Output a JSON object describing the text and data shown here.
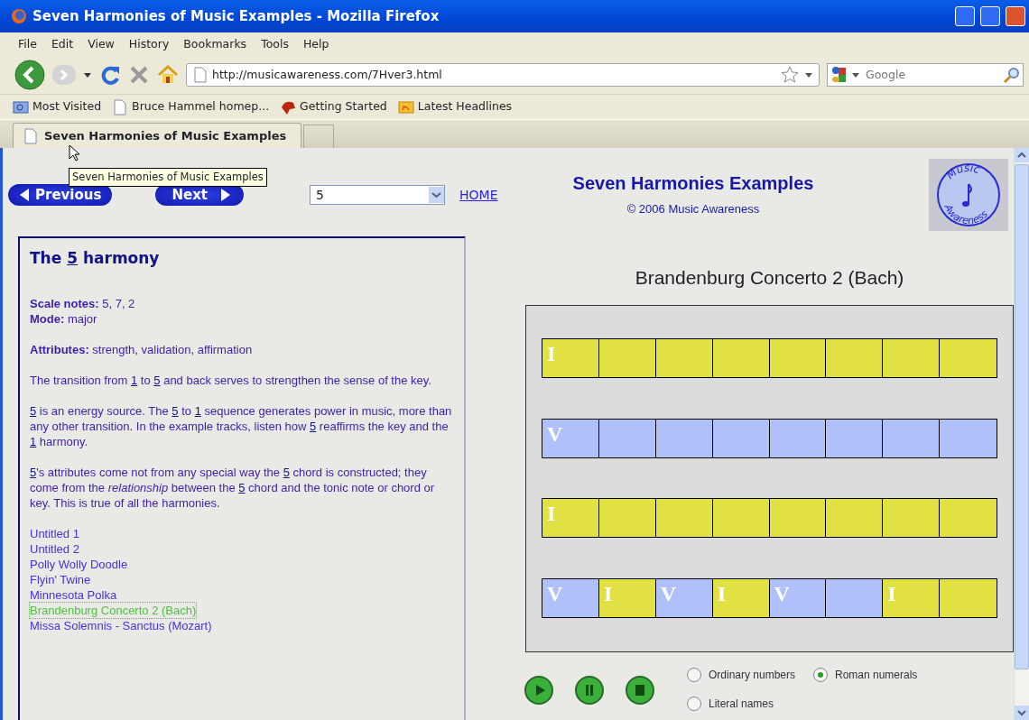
{
  "window": {
    "title": "Seven Harmonies of Music Examples - Mozilla Firefox"
  },
  "menu": [
    "File",
    "Edit",
    "View",
    "History",
    "Bookmarks",
    "Tools",
    "Help"
  ],
  "toolbar": {
    "url": "http://musicawareness.com/7Hver3.html",
    "search_placeholder": "Google"
  },
  "bookmarks": [
    {
      "label": "Most Visited",
      "kind": "smart"
    },
    {
      "label": "Bruce Hammel homep...",
      "kind": "page"
    },
    {
      "label": "Getting Started",
      "kind": "start"
    },
    {
      "label": "Latest Headlines",
      "kind": "feed"
    }
  ],
  "tabs": [
    {
      "label": "Seven Harmonies of Music Examples",
      "selected": true
    }
  ],
  "tooltip": "Seven Harmonies of Music Examples",
  "page": {
    "nav_buttons": [
      {
        "label": "Previous",
        "kind": "prev"
      },
      {
        "label": "Next",
        "kind": "next"
      }
    ],
    "harmony_select": "5",
    "home_link": "HOME",
    "heading": "Seven Harmonies Examples",
    "copyright": "© 2006 Music Awareness",
    "logo": {
      "top": "Music",
      "bottom": "Awareness"
    }
  },
  "info": {
    "title": [
      {
        "text": "The ",
        "kind": "plain"
      },
      {
        "text": "5",
        "kind": "link"
      },
      {
        "text": " harmony",
        "kind": "plain"
      }
    ],
    "facts": [
      {
        "label": "Scale notes:",
        "value": "5, 7, 2"
      },
      {
        "label": "Mode:",
        "value": "major"
      }
    ],
    "attributes": {
      "label": "Attributes:",
      "value": "strength, validation, affirmation"
    },
    "paragraphs": [
      [
        {
          "text": "The transition from ",
          "kind": "plain"
        },
        {
          "text": "1",
          "kind": "link"
        },
        {
          "text": " to ",
          "kind": "plain"
        },
        {
          "text": "5",
          "kind": "link"
        },
        {
          "text": " and back serves to strengthen the sense of the key.",
          "kind": "plain"
        }
      ],
      [
        {
          "text": "5",
          "kind": "link"
        },
        {
          "text": " is an energy source. The ",
          "kind": "plain"
        },
        {
          "text": "5",
          "kind": "link"
        },
        {
          "text": " to ",
          "kind": "plain"
        },
        {
          "text": "1",
          "kind": "link"
        },
        {
          "text": " sequence generates power in music, more than any other transition. In the example tracks, listen how ",
          "kind": "plain"
        },
        {
          "text": "5",
          "kind": "link"
        },
        {
          "text": " reaffirms the key and the ",
          "kind": "plain"
        },
        {
          "text": "1",
          "kind": "link"
        },
        {
          "text": " harmony.",
          "kind": "plain"
        }
      ],
      [
        {
          "text": "5",
          "kind": "link"
        },
        {
          "text": "'s attributes come not from any special way the ",
          "kind": "plain"
        },
        {
          "text": "5",
          "kind": "link"
        },
        {
          "text": " chord is constructed; they come from the *relationship* between the ",
          "kind": "plain"
        },
        {
          "text": "5",
          "kind": "link"
        },
        {
          "text": " chord and the tonic note or chord or key. This is true of all the harmonies.",
          "kind": "plain"
        }
      ]
    ],
    "tracks": [
      {
        "title": "Untitled 1",
        "selected": false
      },
      {
        "title": "Untitled 2",
        "selected": false
      },
      {
        "title": "Polly Wolly Doodle",
        "selected": false
      },
      {
        "title": "Flyin' Twine",
        "selected": false
      },
      {
        "title": "Minnesota Polka",
        "selected": false
      },
      {
        "title": "Brandenburg Concerto 2 (Bach)",
        "selected": true
      },
      {
        "title": "Missa Solemnis - Sanctus (Mozart)",
        "selected": false
      }
    ]
  },
  "player": {
    "title": "Brandenburg Concerto 2 (Bach)",
    "rows": [
      [
        {
          "color": "#e1e144",
          "label": "I"
        },
        {
          "color": "#e1e144"
        },
        {
          "color": "#e1e144"
        },
        {
          "color": "#e1e144"
        },
        {
          "color": "#e1e144"
        },
        {
          "color": "#e1e144"
        },
        {
          "color": "#e1e144"
        },
        {
          "color": "#e1e144"
        }
      ],
      [
        {
          "color": "#b0c0fa",
          "label": "V"
        },
        {
          "color": "#b0c0fa"
        },
        {
          "color": "#b0c0fa"
        },
        {
          "color": "#b0c0fa"
        },
        {
          "color": "#b0c0fa"
        },
        {
          "color": "#b0c0fa"
        },
        {
          "color": "#b0c0fa"
        },
        {
          "color": "#b0c0fa"
        }
      ],
      [
        {
          "color": "#e1e144",
          "label": "I"
        },
        {
          "color": "#e1e144"
        },
        {
          "color": "#e1e144"
        },
        {
          "color": "#e1e144"
        },
        {
          "color": "#e1e144"
        },
        {
          "color": "#e1e144"
        },
        {
          "color": "#e1e144"
        },
        {
          "color": "#e1e144"
        }
      ],
      [
        {
          "color": "#b0c0fa",
          "label": "V"
        },
        {
          "color": "#e1e144",
          "label": "I"
        },
        {
          "color": "#b0c0fa",
          "label": "V"
        },
        {
          "color": "#e1e144",
          "label": "I"
        },
        {
          "color": "#b0c0fa",
          "label": "V"
        },
        {
          "color": "#b0c0fa"
        },
        {
          "color": "#e1e144",
          "label": "I"
        },
        {
          "color": "#e1e144"
        }
      ]
    ],
    "controls": [
      {
        "kind": "play"
      },
      {
        "kind": "pause"
      },
      {
        "kind": "stop"
      }
    ],
    "display_options": [
      {
        "label": "Ordinary numbers",
        "selected": false
      },
      {
        "label": "Roman numerals",
        "selected": true
      },
      {
        "label": "Literal names",
        "selected": false
      }
    ]
  }
}
